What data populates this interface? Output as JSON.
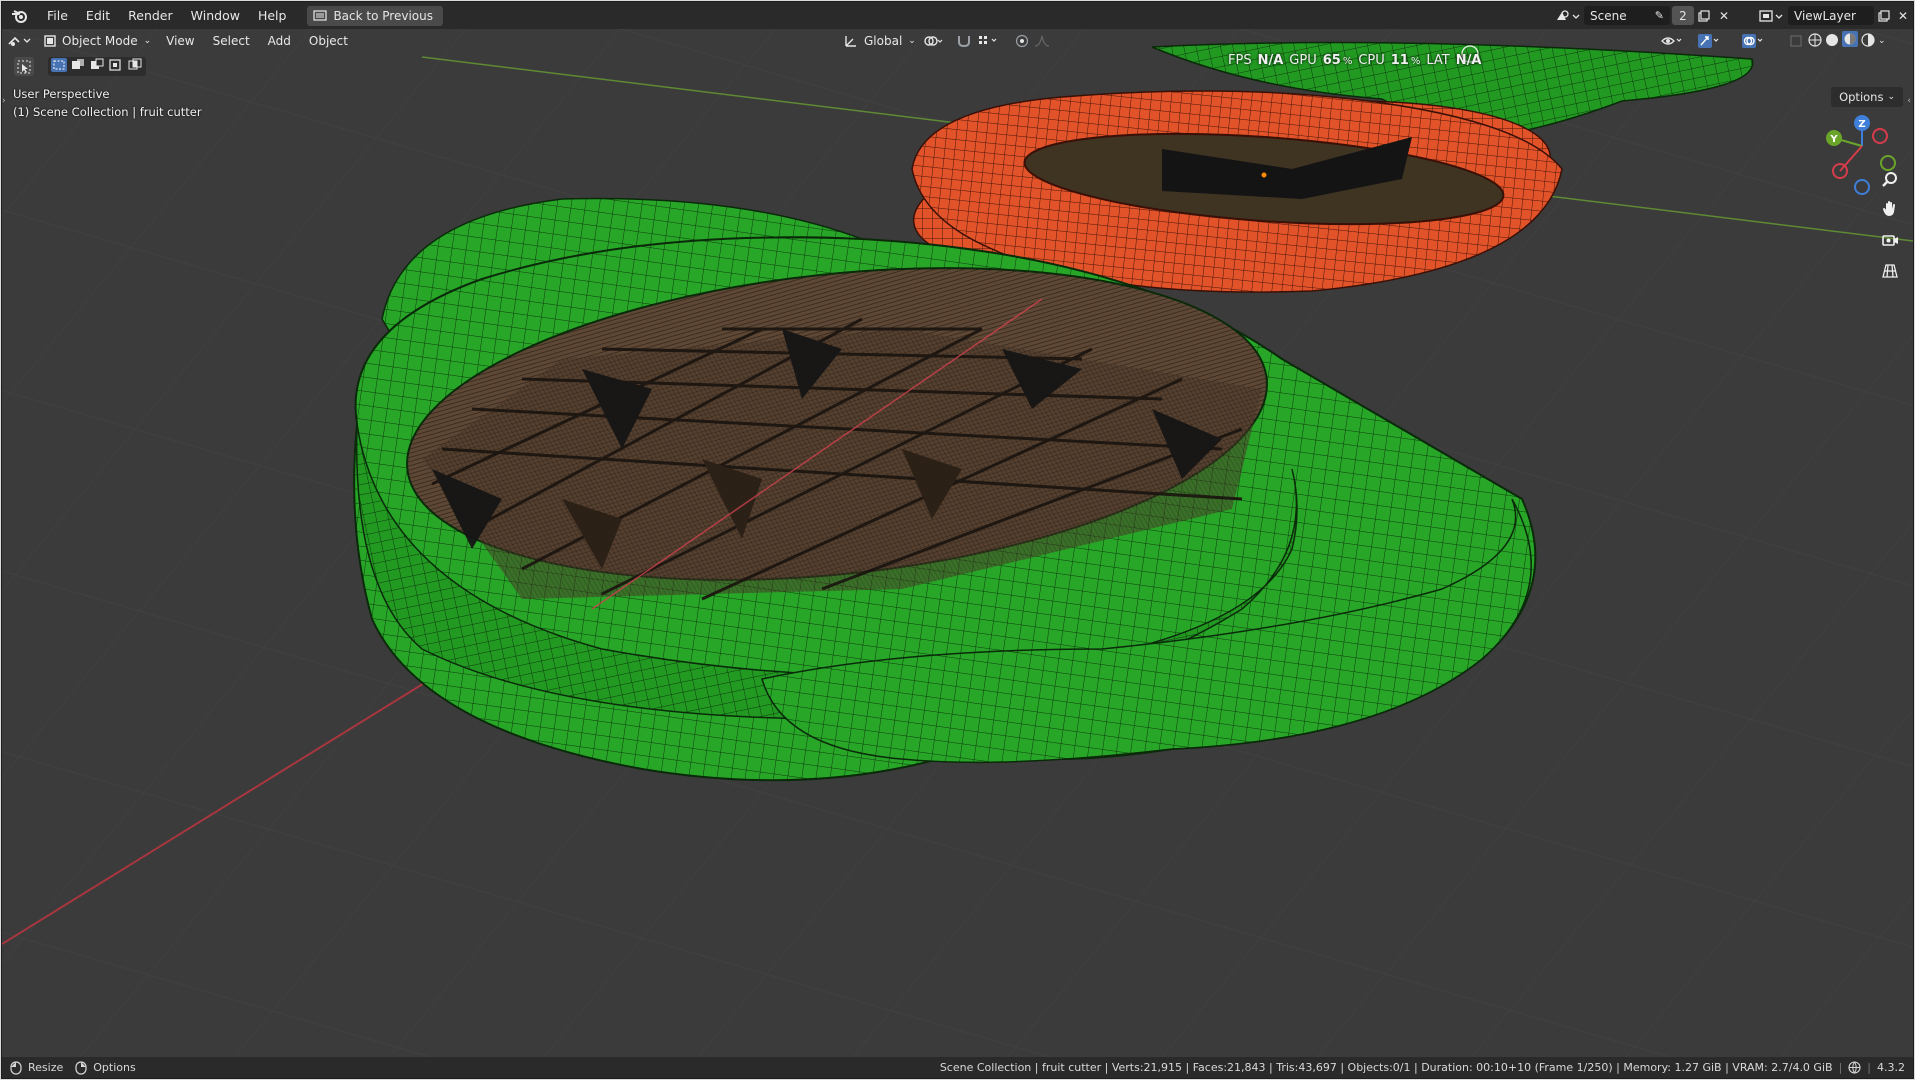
{
  "menu": {
    "items": [
      "File",
      "Edit",
      "Render",
      "Window",
      "Help"
    ],
    "back_button": "Back to Previous"
  },
  "scene": {
    "name": "Scene",
    "count": "2",
    "view_layer": "ViewLayer"
  },
  "header": {
    "mode": "Object Mode",
    "menus": [
      "View",
      "Select",
      "Add",
      "Object"
    ],
    "transform_orientation": "Global"
  },
  "stats": {
    "fps_label": "FPS",
    "fps_value": "N/A",
    "gpu_label": "GPU",
    "gpu_value": "65",
    "cpu_label": "CPU",
    "cpu_value": "11",
    "lat_label": "LAT",
    "lat_value": "N/A",
    "percent": "%"
  },
  "viewport": {
    "perspective": "User Perspective",
    "collection": "(1) Scene Collection | fruit cutter",
    "options": "Options",
    "gizmo_axes": [
      "Z",
      "Y",
      "X"
    ],
    "colors": {
      "background": "#3b3b3b",
      "green_object": "#27a527",
      "orange_object": "#e2522a",
      "wood": "#5a4532",
      "x_axis": "#a8363f",
      "y_axis": "#6f9a3a"
    }
  },
  "status": {
    "resize": "Resize",
    "options": "Options",
    "info": "Scene Collection | fruit cutter | Verts:21,915 | Faces:21,843 | Tris:43,697 | Objects:0/1 | Duration: 00:10+10 (Frame 1/250) | Memory: 1.27 GiB | VRAM: 2.7/4.0 GiB",
    "version": "4.3.2"
  }
}
